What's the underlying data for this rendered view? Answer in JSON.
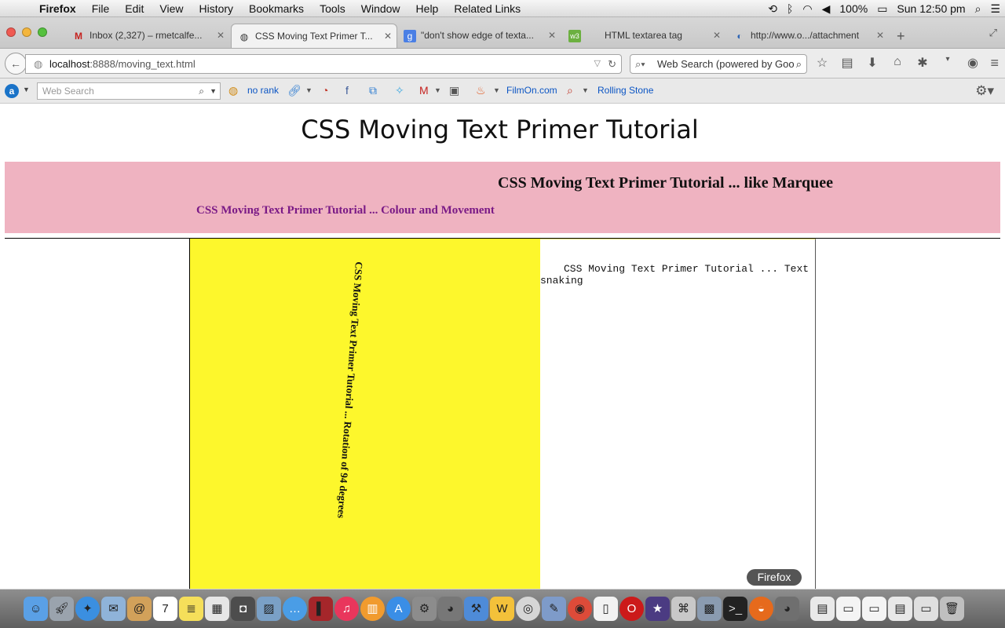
{
  "menubar": {
    "app_name": "Firefox",
    "items": [
      "File",
      "Edit",
      "View",
      "History",
      "Bookmarks",
      "Tools",
      "Window",
      "Help",
      "Related Links"
    ],
    "battery": "100%",
    "clock": "Sun 12:50 pm"
  },
  "tabs": [
    {
      "title": "Inbox (2,327) – rmetcalfe...",
      "icon": "gmail-icon"
    },
    {
      "title": "CSS Moving Text Primer T...",
      "icon": "globe-icon",
      "active": true
    },
    {
      "title": "\"don't show edge of texta...",
      "icon": "google-icon"
    },
    {
      "title": "HTML textarea tag",
      "icon": "w3-icon"
    },
    {
      "title": "http://www.o.../attachment",
      "icon": "page-icon"
    }
  ],
  "navbar": {
    "url_host": "localhost",
    "url_rest": ":8888/moving_text.html",
    "search_placeholder": "Web Search (powered by Goo"
  },
  "toolbar": {
    "search_placeholder": "Web Search",
    "rank_label": "no rank",
    "filmon_label": "FilmOn.com",
    "rolling_stone_label": "Rolling Stone"
  },
  "page": {
    "title": "CSS Moving Text Primer Tutorial",
    "marquee_text": "CSS Moving Text Primer Tutorial ... like Marquee",
    "colour_text": "CSS Moving Text Primer Tutorial ... Colour and Movement",
    "rotation_text": "CSS Moving Text Primer Tutorial ... Rotation of 94 degrees",
    "snaking_text": "CSS Moving Text Primer Tutorial ... Text snaking"
  },
  "dock": {
    "tooltip": "Firefox"
  },
  "colors": {
    "marquee_bg": "#efb3c1",
    "colour_text": "#7a1a86",
    "yellow_panel": "#fdf72c"
  }
}
